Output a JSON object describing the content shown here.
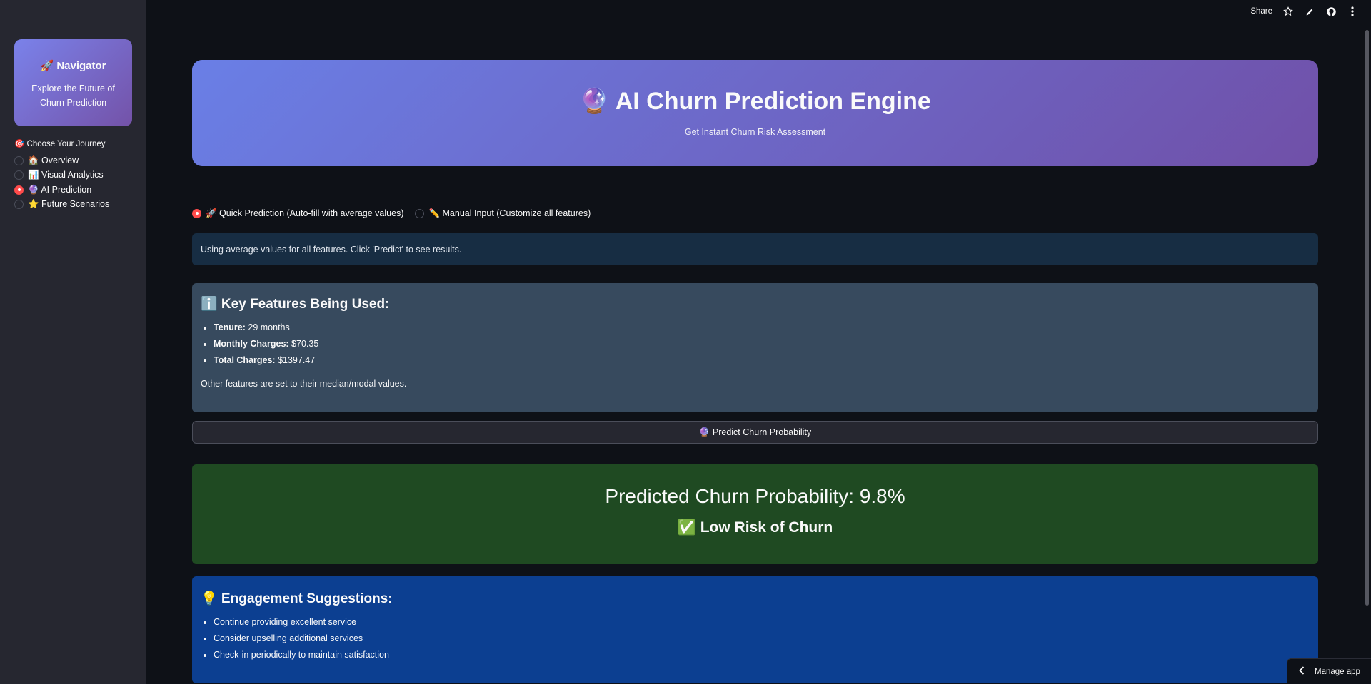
{
  "sidebar": {
    "card": {
      "title": "🚀 Navigator",
      "subtitle": "Explore the Future of Churn Prediction"
    },
    "journey_label": "🎯 Choose Your Journey",
    "items": [
      {
        "label": "🏠 Overview",
        "selected": false
      },
      {
        "label": "📊 Visual Analytics",
        "selected": false
      },
      {
        "label": "🔮 AI Prediction",
        "selected": true
      },
      {
        "label": "⭐ Future Scenarios",
        "selected": false
      }
    ]
  },
  "topbar": {
    "share_label": "Share",
    "icons": [
      "star-icon",
      "edit-icon",
      "github-icon",
      "more-icon"
    ]
  },
  "hero": {
    "title": "🔮 AI Churn Prediction Engine",
    "subtitle": "Get Instant Churn Risk Assessment"
  },
  "mode": {
    "options": [
      {
        "label": "🚀 Quick Prediction (Auto-fill with average values)",
        "selected": true
      },
      {
        "label": "✏️ Manual Input (Customize all features)",
        "selected": false
      }
    ]
  },
  "info": {
    "text": "Using average values for all features. Click 'Predict' to see results."
  },
  "features": {
    "heading": "ℹ️ Key Features Being Used:",
    "items": [
      {
        "key": "Tenure:",
        "value": " 29 months"
      },
      {
        "key": "Monthly Charges:",
        "value": " $70.35"
      },
      {
        "key": "Total Charges:",
        "value": " $1397.47"
      }
    ],
    "footnote": "Other features are set to their median/modal values."
  },
  "predict_button": {
    "label": "🔮 Predict Churn Probability"
  },
  "result": {
    "probability_text": "Predicted Churn Probability: 9.8%",
    "probability_value": 9.8,
    "risk_text": "✅ Low Risk of Churn"
  },
  "suggestions": {
    "heading": "💡 Engagement Suggestions:",
    "items": [
      "Continue providing excellent service",
      "Consider upselling additional services",
      "Check-in periodically to maintain satisfaction"
    ]
  },
  "manage_app": {
    "label": "Manage app"
  },
  "colors": {
    "background": "#0e1117",
    "sidebar": "#262730",
    "accent_red": "#ff4b4b",
    "info_bg": "#172d43",
    "features_bg": "#374a5e",
    "success_bg": "#1f4a22",
    "suggest_bg": "#0c3f91"
  }
}
